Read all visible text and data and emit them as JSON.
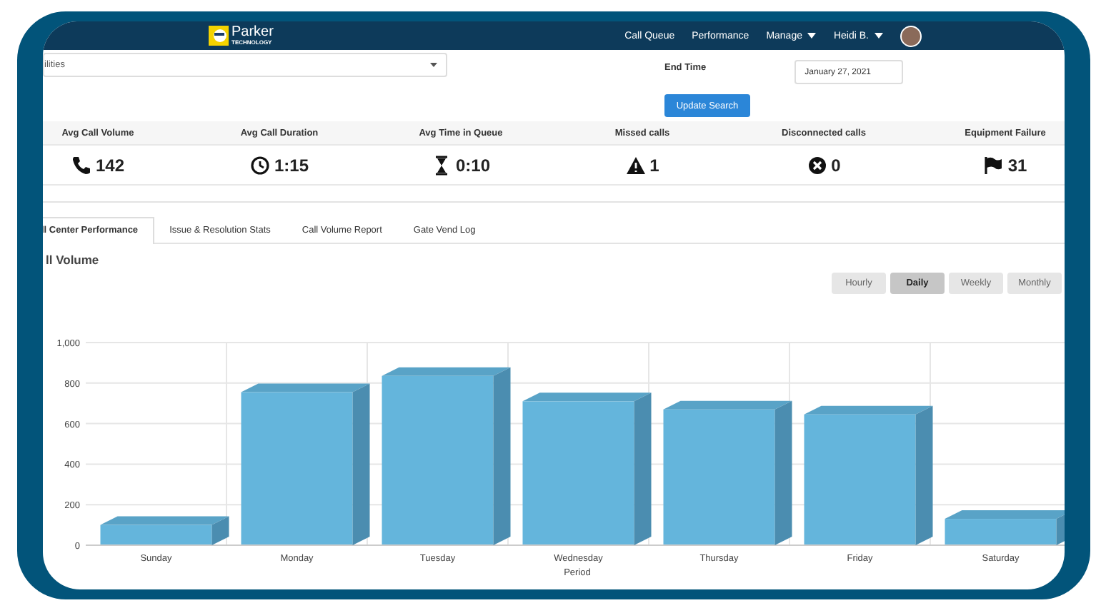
{
  "navbar": {
    "logo": {
      "name": "Parker",
      "tagline": "TECHNOLOGY"
    },
    "links": [
      {
        "label": "Call Queue",
        "dropdown": false
      },
      {
        "label": "Performance",
        "dropdown": false
      },
      {
        "label": "Manage",
        "dropdown": true
      },
      {
        "label": "Heidi B.",
        "dropdown": true
      }
    ]
  },
  "filters": {
    "facility_select": {
      "value": "ilities"
    },
    "end_time": {
      "label": "End Time",
      "value": "January 27, 2021"
    },
    "update_button": "Update Search"
  },
  "stats": [
    {
      "kind": "volume",
      "label": "Avg Call Volume",
      "value": "142"
    },
    {
      "kind": "duration",
      "label": "Avg Call Duration",
      "value": "1:15"
    },
    {
      "kind": "queue",
      "label": "Avg Time in Queue",
      "value": "0:10"
    },
    {
      "kind": "missed",
      "label": "Missed calls",
      "value": "1"
    },
    {
      "kind": "disconnected",
      "label": "Disconnected calls",
      "value": "0"
    },
    {
      "kind": "failure",
      "label": "Equipment Failure",
      "value": "31"
    }
  ],
  "tabs": [
    {
      "label": "ll Center Performance",
      "selected": true
    },
    {
      "label": "Issue & Resolution Stats",
      "selected": false
    },
    {
      "label": "Call Volume Report",
      "selected": false
    },
    {
      "label": "Gate Vend Log",
      "selected": false
    }
  ],
  "chart_panel": {
    "title": "ll Volume",
    "periods": [
      {
        "label": "Hourly",
        "selected": false
      },
      {
        "label": "Daily",
        "selected": true
      },
      {
        "label": "Weekly",
        "selected": false
      },
      {
        "label": "Monthly",
        "selected": false
      }
    ],
    "chart_data": {
      "type": "bar",
      "xlabel": "Period",
      "grid": true,
      "categories": [
        "Sunday",
        "Monday",
        "Tuesday",
        "Wednesday",
        "Thursday",
        "Friday",
        "Saturday"
      ],
      "values": [
        100,
        755,
        835,
        710,
        670,
        645,
        130
      ],
      "ylim": [
        0,
        1000
      ],
      "yticks": [
        0,
        200,
        400,
        600,
        800,
        {
          "value": 1000,
          "label": "1,000"
        }
      ]
    }
  }
}
